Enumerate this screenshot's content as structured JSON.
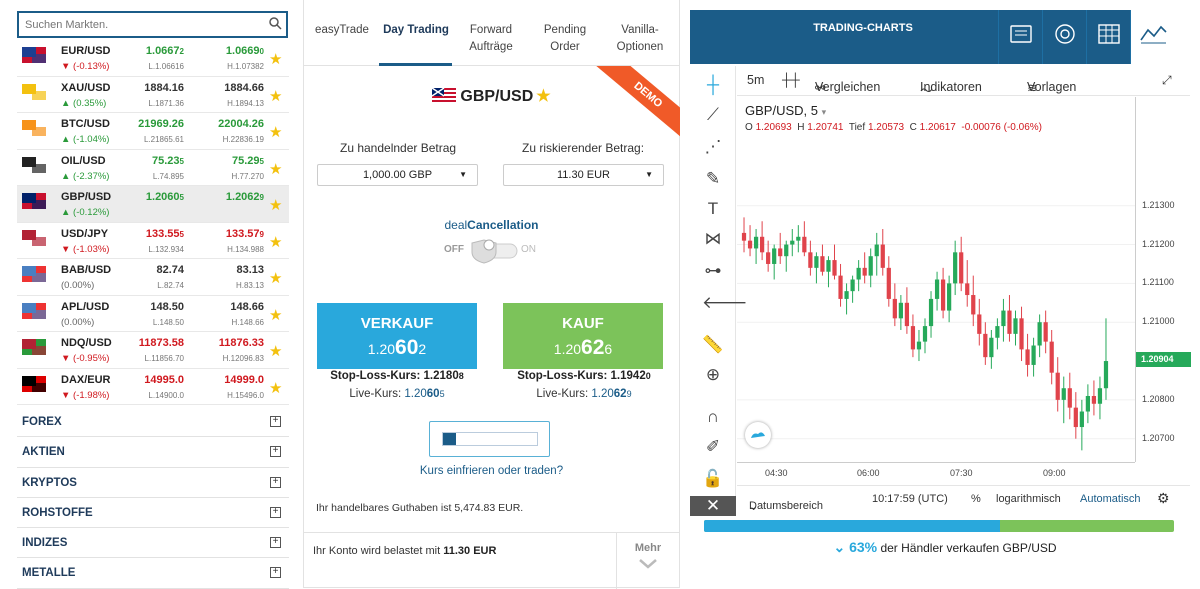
{
  "search": {
    "placeholder": "Suchen Markten."
  },
  "instruments": [
    {
      "symbol": "EUR/USD",
      "change": "(-0.13%)",
      "dir": "dn",
      "bid": "1.0667",
      "bid_sub": "2",
      "low": "L.1.06616",
      "ask": "1.0669",
      "ask_sub": "0",
      "high": "H.1.07382",
      "color": "up"
    },
    {
      "symbol": "XAU/USD",
      "change": "(0.35%)",
      "dir": "up",
      "bid": "1884.16",
      "bid_sub": "",
      "low": "L.1871.36",
      "ask": "1884.66",
      "ask_sub": "",
      "high": "H.1894.13",
      "color": "nt"
    },
    {
      "symbol": "BTC/USD",
      "change": "(-1.04%)",
      "dir": "up",
      "bid": "21969.26",
      "bid_sub": "",
      "low": "L.21865.61",
      "ask": "22004.26",
      "ask_sub": "",
      "high": "H.22836.19",
      "color": "up"
    },
    {
      "symbol": "OIL/USD",
      "change": "(-2.37%)",
      "dir": "up",
      "bid": "75.23",
      "bid_sub": "5",
      "low": "L.74.895",
      "ask": "75.29",
      "ask_sub": "5",
      "high": "H.77.270",
      "color": "up"
    },
    {
      "symbol": "GBP/USD",
      "change": "(-0.12%)",
      "dir": "up",
      "bid": "1.2060",
      "bid_sub": "5",
      "low": "",
      "ask": "1.2062",
      "ask_sub": "9",
      "high": "",
      "color": "up",
      "selected": true
    },
    {
      "symbol": "USD/JPY",
      "change": "(-1.03%)",
      "dir": "dn",
      "bid": "133.55",
      "bid_sub": "5",
      "low": "L.132.934",
      "ask": "133.57",
      "ask_sub": "9",
      "high": "H.134.988",
      "color": "dn"
    },
    {
      "symbol": "BAB/USD",
      "change": "(0.00%)",
      "dir": "nt",
      "bid": "82.74",
      "bid_sub": "",
      "low": "L.82.74",
      "ask": "83.13",
      "ask_sub": "",
      "high": "H.83.13",
      "color": "nt"
    },
    {
      "symbol": "APL/USD",
      "change": "(0.00%)",
      "dir": "nt",
      "bid": "148.50",
      "bid_sub": "",
      "low": "L.148.50",
      "ask": "148.66",
      "ask_sub": "",
      "high": "H.148.66",
      "color": "nt"
    },
    {
      "symbol": "NDQ/USD",
      "change": "(-0.95%)",
      "dir": "dn",
      "bid": "11873.58",
      "bid_sub": "",
      "low": "L.11856.70",
      "ask": "11876.33",
      "ask_sub": "",
      "high": "H.12096.83",
      "color": "dn"
    },
    {
      "symbol": "DAX/EUR",
      "change": "(-1.98%)",
      "dir": "dn",
      "bid": "14995.0",
      "bid_sub": "",
      "low": "L.14900.0",
      "ask": "14999.0",
      "ask_sub": "",
      "high": "H.15496.0",
      "color": "dn"
    }
  ],
  "categories": [
    "FOREX",
    "AKTIEN",
    "KRYPTOS",
    "ROHSTOFFE",
    "INDIZES",
    "METALLE"
  ],
  "tabs": [
    {
      "label1": "easyTrade",
      "label2": ""
    },
    {
      "label1": "Day Trading",
      "label2": ""
    },
    {
      "label1": "Forward",
      "label2": "Aufträge"
    },
    {
      "label1": "Pending",
      "label2": "Order"
    },
    {
      "label1": "Vanilla-",
      "label2": "Optionen"
    }
  ],
  "trade": {
    "demo": "DEMO",
    "pair": "GBP/USD",
    "amount_label": "Zu handelnder Betrag",
    "amount_value": "1,000.00 GBP",
    "risk_label": "Zu riskierender Betrag:",
    "risk_value": "11.30 EUR",
    "deal_a": "deal",
    "deal_b": "Cancellation",
    "off": "OFF",
    "on": "ON",
    "sell_label": "VERKAUF",
    "sell_price_a": "1.20",
    "sell_price_b": "60",
    "sell_price_c": "2",
    "buy_label": "KAUF",
    "buy_price_a": "1.20",
    "buy_price_b": "62",
    "buy_price_c": "6",
    "sell_sl": "Stop-Loss-Kurs: 1.2180",
    "sell_sl_sub": "8",
    "buy_sl": "Stop-Loss-Kurs: 1.1942",
    "buy_sl_sub": "0",
    "sell_live_label": "Live-Kurs: ",
    "sell_live_a": "1.20",
    "sell_live_b": "60",
    "sell_live_c": "5",
    "buy_live_label": "Live-Kurs: ",
    "buy_live_a": "1.20",
    "buy_live_b": "62",
    "buy_live_c": "9",
    "freeze_progress": 0.14,
    "freeze_text": "Kurs einfrieren oder traden?",
    "balance": "Ihr handelbares Guthaben ist 5,474.83 EUR.",
    "account_text": "Ihr Konto wird belastet mit ",
    "account_amount": "11.30 EUR",
    "more": "Mehr"
  },
  "chart": {
    "header_title": "TRADING-CHARTS",
    "interval": "5m",
    "compare": "Vergleichen",
    "indicators": "Indikatoren",
    "templates": "Vorlagen",
    "symbol_title": "GBP/USD, 5",
    "o_label": "O",
    "o": "1.20693",
    "h_label": "H",
    "h": "1.20741",
    "l_label": "Tief",
    "l": "1.20573",
    "c_label": "C",
    "c": "1.20617",
    "delta": "-0.00076 (-0.06%)",
    "last_price": "1.20904",
    "date_range": "Datumsbereich",
    "time": "10:17:59 (UTC)",
    "pct": "%",
    "log": "logarithmisch",
    "auto": "Automatisch"
  },
  "chart_data": {
    "type": "candlestick",
    "y_ticks": [
      "1.21300",
      "1.21200",
      "1.21100",
      "1.21000",
      "1.20800",
      "1.20700"
    ],
    "y_tick_values": [
      1.213,
      1.212,
      1.211,
      1.21,
      1.208,
      1.207
    ],
    "ylim": [
      1.2064,
      1.2158
    ],
    "x_ticks": [
      "04:30",
      "06:00",
      "07:30",
      "09:00"
    ],
    "last_price": 1.20904,
    "candles": [
      [
        1.2123,
        1.2127,
        1.2118,
        1.2121
      ],
      [
        1.2121,
        1.2125,
        1.2117,
        1.2119
      ],
      [
        1.2119,
        1.2124,
        1.2115,
        1.2122
      ],
      [
        1.2122,
        1.2126,
        1.2116,
        1.2118
      ],
      [
        1.2118,
        1.2121,
        1.2113,
        1.2115
      ],
      [
        1.2115,
        1.212,
        1.2111,
        1.2119
      ],
      [
        1.2119,
        1.2123,
        1.2115,
        1.2117
      ],
      [
        1.2117,
        1.2121,
        1.2113,
        1.212
      ],
      [
        1.212,
        1.2124,
        1.2117,
        1.2121
      ],
      [
        1.2121,
        1.2125,
        1.2118,
        1.2122
      ],
      [
        1.2122,
        1.2126,
        1.2117,
        1.2118
      ],
      [
        1.2118,
        1.2121,
        1.2112,
        1.2114
      ],
      [
        1.2114,
        1.2118,
        1.211,
        1.2117
      ],
      [
        1.2117,
        1.212,
        1.2112,
        1.2113
      ],
      [
        1.2113,
        1.2117,
        1.2109,
        1.2116
      ],
      [
        1.2116,
        1.212,
        1.2111,
        1.2112
      ],
      [
        1.2112,
        1.2115,
        1.2104,
        1.2106
      ],
      [
        1.2106,
        1.211,
        1.2102,
        1.2108
      ],
      [
        1.2108,
        1.2112,
        1.2105,
        1.2111
      ],
      [
        1.2111,
        1.2116,
        1.2108,
        1.2114
      ],
      [
        1.2114,
        1.2118,
        1.211,
        1.2112
      ],
      [
        1.2112,
        1.2119,
        1.2109,
        1.2117
      ],
      [
        1.2117,
        1.2123,
        1.2112,
        1.212
      ],
      [
        1.212,
        1.2124,
        1.2112,
        1.2114
      ],
      [
        1.2114,
        1.2117,
        1.2104,
        1.2106
      ],
      [
        1.2106,
        1.211,
        1.2099,
        1.2101
      ],
      [
        1.2101,
        1.2107,
        1.2098,
        1.2105
      ],
      [
        1.2105,
        1.2109,
        1.2097,
        1.2099
      ],
      [
        1.2099,
        1.2102,
        1.2091,
        1.2093
      ],
      [
        1.2093,
        1.2098,
        1.209,
        1.2095
      ],
      [
        1.2095,
        1.2101,
        1.2092,
        1.2099
      ],
      [
        1.2099,
        1.2108,
        1.2096,
        1.2106
      ],
      [
        1.2106,
        1.2113,
        1.2103,
        1.2111
      ],
      [
        1.2111,
        1.2114,
        1.2101,
        1.2103
      ],
      [
        1.2103,
        1.2112,
        1.21,
        1.211
      ],
      [
        1.211,
        1.2121,
        1.2107,
        1.2118
      ],
      [
        1.2118,
        1.2122,
        1.2108,
        1.211
      ],
      [
        1.211,
        1.2116,
        1.2104,
        1.2107
      ],
      [
        1.2107,
        1.2112,
        1.2099,
        1.2102
      ],
      [
        1.2102,
        1.2106,
        1.2094,
        1.2097
      ],
      [
        1.2097,
        1.21,
        1.2089,
        1.2091
      ],
      [
        1.2091,
        1.2098,
        1.2088,
        1.2096
      ],
      [
        1.2096,
        1.2101,
        1.2093,
        1.2099
      ],
      [
        1.2099,
        1.2106,
        1.2095,
        1.2103
      ],
      [
        1.2103,
        1.2107,
        1.2095,
        1.2097
      ],
      [
        1.2097,
        1.2103,
        1.2094,
        1.2101
      ],
      [
        1.2101,
        1.2104,
        1.209,
        1.2093
      ],
      [
        1.2093,
        1.2097,
        1.2086,
        1.2089
      ],
      [
        1.2089,
        1.2096,
        1.2086,
        1.2094
      ],
      [
        1.2094,
        1.2102,
        1.2091,
        1.21
      ],
      [
        1.21,
        1.2103,
        1.2092,
        1.2095
      ],
      [
        1.2095,
        1.2098,
        1.2084,
        1.2087
      ],
      [
        1.2087,
        1.2091,
        1.2077,
        1.208
      ],
      [
        1.208,
        1.2086,
        1.2074,
        1.2083
      ],
      [
        1.2083,
        1.2087,
        1.2075,
        1.2078
      ],
      [
        1.2078,
        1.2082,
        1.207,
        1.2073
      ],
      [
        1.2073,
        1.208,
        1.2067,
        1.2077
      ],
      [
        1.2077,
        1.2084,
        1.2074,
        1.2081
      ],
      [
        1.2081,
        1.2085,
        1.2076,
        1.2079
      ],
      [
        1.2079,
        1.2086,
        1.2075,
        1.2083
      ],
      [
        1.2083,
        1.2101,
        1.208,
        1.209
      ]
    ]
  },
  "sentiment": {
    "percent_value": 0.63,
    "percent": "63%",
    "text": " der Händler verkaufen GBP/USD",
    "sell_color": "#29a8dc",
    "buy_color": "#7cc35a"
  },
  "colors": {
    "brand": "#1b5c88",
    "sell": "#29a8dc",
    "buy": "#7cc35a",
    "up": "#2a9a3a",
    "down": "#d0191f",
    "star": "#f3c10f",
    "demo": "#f05a28"
  }
}
